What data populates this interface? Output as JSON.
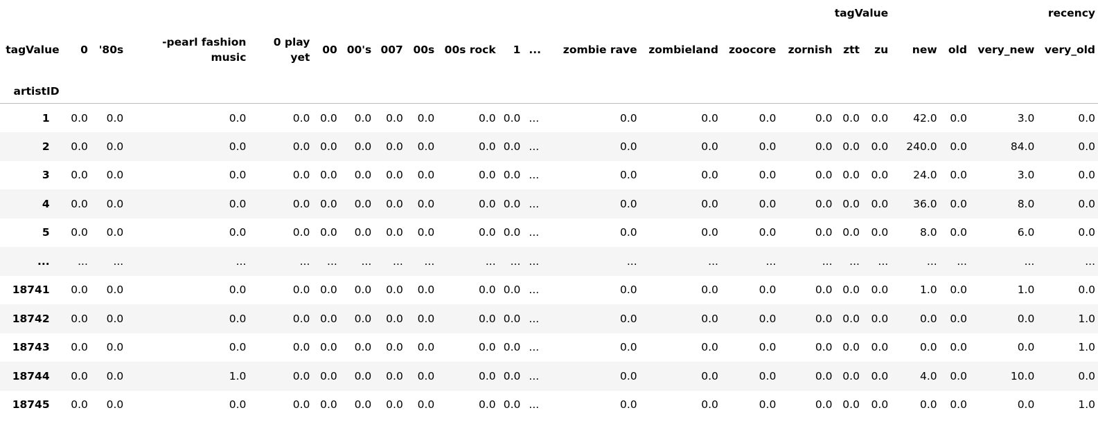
{
  "top_header": {
    "index_label": "",
    "group1_label": "tagValue",
    "group2_label": "recency"
  },
  "columns_header_index_label": "tagValue",
  "index_name": "artistID",
  "columns": [
    "0",
    "'80s",
    "-pearl fashion music",
    "0 play yet",
    "00",
    "00's",
    "007",
    "00s",
    "00s rock",
    "1",
    "...",
    "zombie rave",
    "zombieland",
    "zoocore",
    "zornish",
    "ztt",
    "zu",
    "new",
    "old",
    "very_new",
    "very_old"
  ],
  "rows": [
    {
      "index": "1",
      "values": [
        "0.0",
        "0.0",
        "0.0",
        "0.0",
        "0.0",
        "0.0",
        "0.0",
        "0.0",
        "0.0",
        "0.0",
        "...",
        "0.0",
        "0.0",
        "0.0",
        "0.0",
        "0.0",
        "0.0",
        "42.0",
        "0.0",
        "3.0",
        "0.0"
      ]
    },
    {
      "index": "2",
      "values": [
        "0.0",
        "0.0",
        "0.0",
        "0.0",
        "0.0",
        "0.0",
        "0.0",
        "0.0",
        "0.0",
        "0.0",
        "...",
        "0.0",
        "0.0",
        "0.0",
        "0.0",
        "0.0",
        "0.0",
        "240.0",
        "0.0",
        "84.0",
        "0.0"
      ]
    },
    {
      "index": "3",
      "values": [
        "0.0",
        "0.0",
        "0.0",
        "0.0",
        "0.0",
        "0.0",
        "0.0",
        "0.0",
        "0.0",
        "0.0",
        "...",
        "0.0",
        "0.0",
        "0.0",
        "0.0",
        "0.0",
        "0.0",
        "24.0",
        "0.0",
        "3.0",
        "0.0"
      ]
    },
    {
      "index": "4",
      "values": [
        "0.0",
        "0.0",
        "0.0",
        "0.0",
        "0.0",
        "0.0",
        "0.0",
        "0.0",
        "0.0",
        "0.0",
        "...",
        "0.0",
        "0.0",
        "0.0",
        "0.0",
        "0.0",
        "0.0",
        "36.0",
        "0.0",
        "8.0",
        "0.0"
      ]
    },
    {
      "index": "5",
      "values": [
        "0.0",
        "0.0",
        "0.0",
        "0.0",
        "0.0",
        "0.0",
        "0.0",
        "0.0",
        "0.0",
        "0.0",
        "...",
        "0.0",
        "0.0",
        "0.0",
        "0.0",
        "0.0",
        "0.0",
        "8.0",
        "0.0",
        "6.0",
        "0.0"
      ]
    },
    {
      "index": "...",
      "values": [
        "...",
        "...",
        "...",
        "...",
        "...",
        "...",
        "...",
        "...",
        "...",
        "...",
        "...",
        "...",
        "...",
        "...",
        "...",
        "...",
        "...",
        "...",
        "...",
        "...",
        "..."
      ]
    },
    {
      "index": "18741",
      "values": [
        "0.0",
        "0.0",
        "0.0",
        "0.0",
        "0.0",
        "0.0",
        "0.0",
        "0.0",
        "0.0",
        "0.0",
        "...",
        "0.0",
        "0.0",
        "0.0",
        "0.0",
        "0.0",
        "0.0",
        "1.0",
        "0.0",
        "1.0",
        "0.0"
      ]
    },
    {
      "index": "18742",
      "values": [
        "0.0",
        "0.0",
        "0.0",
        "0.0",
        "0.0",
        "0.0",
        "0.0",
        "0.0",
        "0.0",
        "0.0",
        "...",
        "0.0",
        "0.0",
        "0.0",
        "0.0",
        "0.0",
        "0.0",
        "0.0",
        "0.0",
        "0.0",
        "1.0"
      ]
    },
    {
      "index": "18743",
      "values": [
        "0.0",
        "0.0",
        "0.0",
        "0.0",
        "0.0",
        "0.0",
        "0.0",
        "0.0",
        "0.0",
        "0.0",
        "...",
        "0.0",
        "0.0",
        "0.0",
        "0.0",
        "0.0",
        "0.0",
        "0.0",
        "0.0",
        "0.0",
        "1.0"
      ]
    },
    {
      "index": "18744",
      "values": [
        "0.0",
        "0.0",
        "1.0",
        "0.0",
        "0.0",
        "0.0",
        "0.0",
        "0.0",
        "0.0",
        "0.0",
        "...",
        "0.0",
        "0.0",
        "0.0",
        "0.0",
        "0.0",
        "0.0",
        "4.0",
        "0.0",
        "10.0",
        "0.0"
      ]
    },
    {
      "index": "18745",
      "values": [
        "0.0",
        "0.0",
        "0.0",
        "0.0",
        "0.0",
        "0.0",
        "0.0",
        "0.0",
        "0.0",
        "0.0",
        "...",
        "0.0",
        "0.0",
        "0.0",
        "0.0",
        "0.0",
        "0.0",
        "0.0",
        "0.0",
        "0.0",
        "1.0"
      ]
    }
  ]
}
